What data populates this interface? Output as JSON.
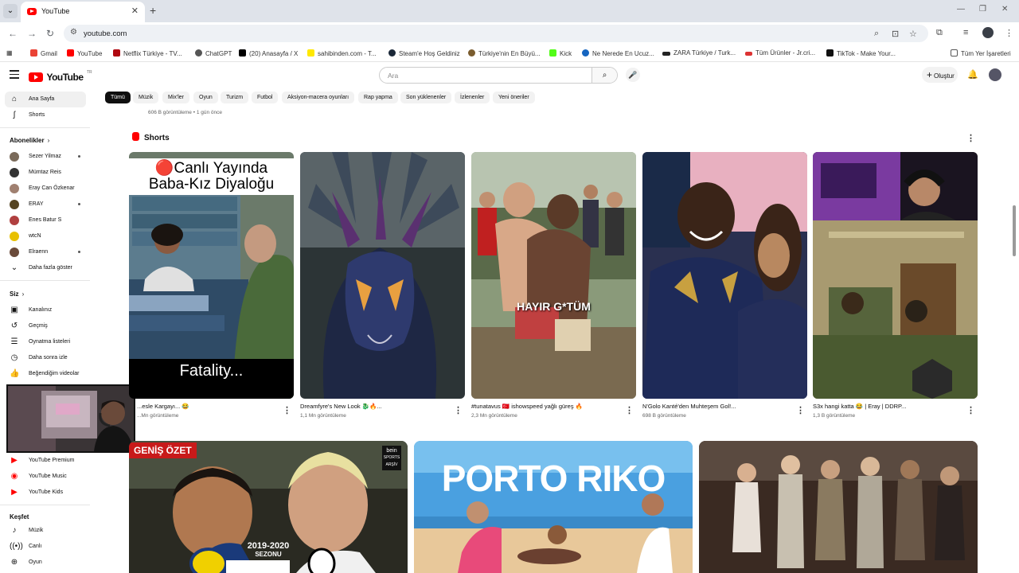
{
  "browser": {
    "tab_title": "YouTube",
    "url": "youtube.com",
    "bookmarks": [
      "Gmail",
      "YouTube",
      "Netflix Türkiye - TV...",
      "ChatGPT",
      "(20) Anasayfa / X",
      "sahibinden.com - T...",
      "Steam'e Hoş Geldiniz",
      "Türkiye'nin En Büyü...",
      "Kick",
      "Ne Nerede En Ucuz...",
      "ZARA Türkiye / Turk...",
      "Tüm Ürünler - Jr.cri...",
      "TikTok - Make Your...",
      "Tüm Yer İşaretleri"
    ]
  },
  "header": {
    "logo_text": "YouTube",
    "country_code": "TR",
    "search_placeholder": "Ara",
    "create_label": "Oluştur"
  },
  "sidebar": {
    "home": "Ana Sayfa",
    "shorts": "Shorts",
    "subscriptions_title": "Abonelikler",
    "subscriptions": [
      "Sezer Yilmaz",
      "Mümtaz Reis",
      "Eray Can Özkenar",
      "ERAY",
      "Enes Batur S",
      "wtcN",
      "Elraenn"
    ],
    "show_more": "Daha fazla göster",
    "you_title": "Siz",
    "you_items": [
      "Kanalınız",
      "Geçmiş",
      "Oynatma listeleri",
      "Daha sonra izle",
      "Beğendiğim videolar"
    ],
    "more_from": [
      "YouTube Premium",
      "YouTube Music",
      "YouTube Kids"
    ],
    "explore_title": "Keşfet",
    "explore_items": [
      "Müzik",
      "Canlı",
      "Oyun"
    ]
  },
  "chips": [
    "Tümü",
    "Müzik",
    "Mix'ler",
    "Oyun",
    "Turizm",
    "Futbol",
    "Aksiyon-macera oyunları",
    "Rap yapma",
    "Son yüklenenler",
    "İzlenenler",
    "Yeni öneriler"
  ],
  "previous_meta": "606 B görüntüleme • 1 gün önce",
  "shorts": {
    "title": "Shorts",
    "items": [
      {
        "title": "...esle Kargayı... 😂",
        "views": "...Mn görüntüleme",
        "overlay_top_1": "🔴Canlı Yayında",
        "overlay_top_2": "Baba-Kız Diyaloğu",
        "overlay_bottom": "Fatality..."
      },
      {
        "title": "Dreamfyre's New Look 🐉🔥...",
        "views": "1,1 Mn görüntüleme"
      },
      {
        "title": "#tunatavus 🇹🇷 ishowspeed yağlı güreş 🔥",
        "views": "2,3 Mn görüntüleme",
        "overlay_mid": "HAYIR G*TÜM"
      },
      {
        "title": "N'Golo Kanté'den Muhteşem Gol!...",
        "views": "698 B görüntüleme"
      },
      {
        "title": "S3x hangi katta 😂 | Eray | DDRP...",
        "views": "1,3 B görüntüleme"
      }
    ]
  },
  "videos": [
    {
      "badge": "GENİŞ ÖZET",
      "season_1": "2019-2020",
      "season_2": "SEZONU",
      "channel_tag_1": "bein",
      "channel_tag_2": "SPORTS",
      "channel_tag_3": "ARŞİV"
    },
    {
      "overlay": "PORTO RIKO"
    },
    {}
  ]
}
